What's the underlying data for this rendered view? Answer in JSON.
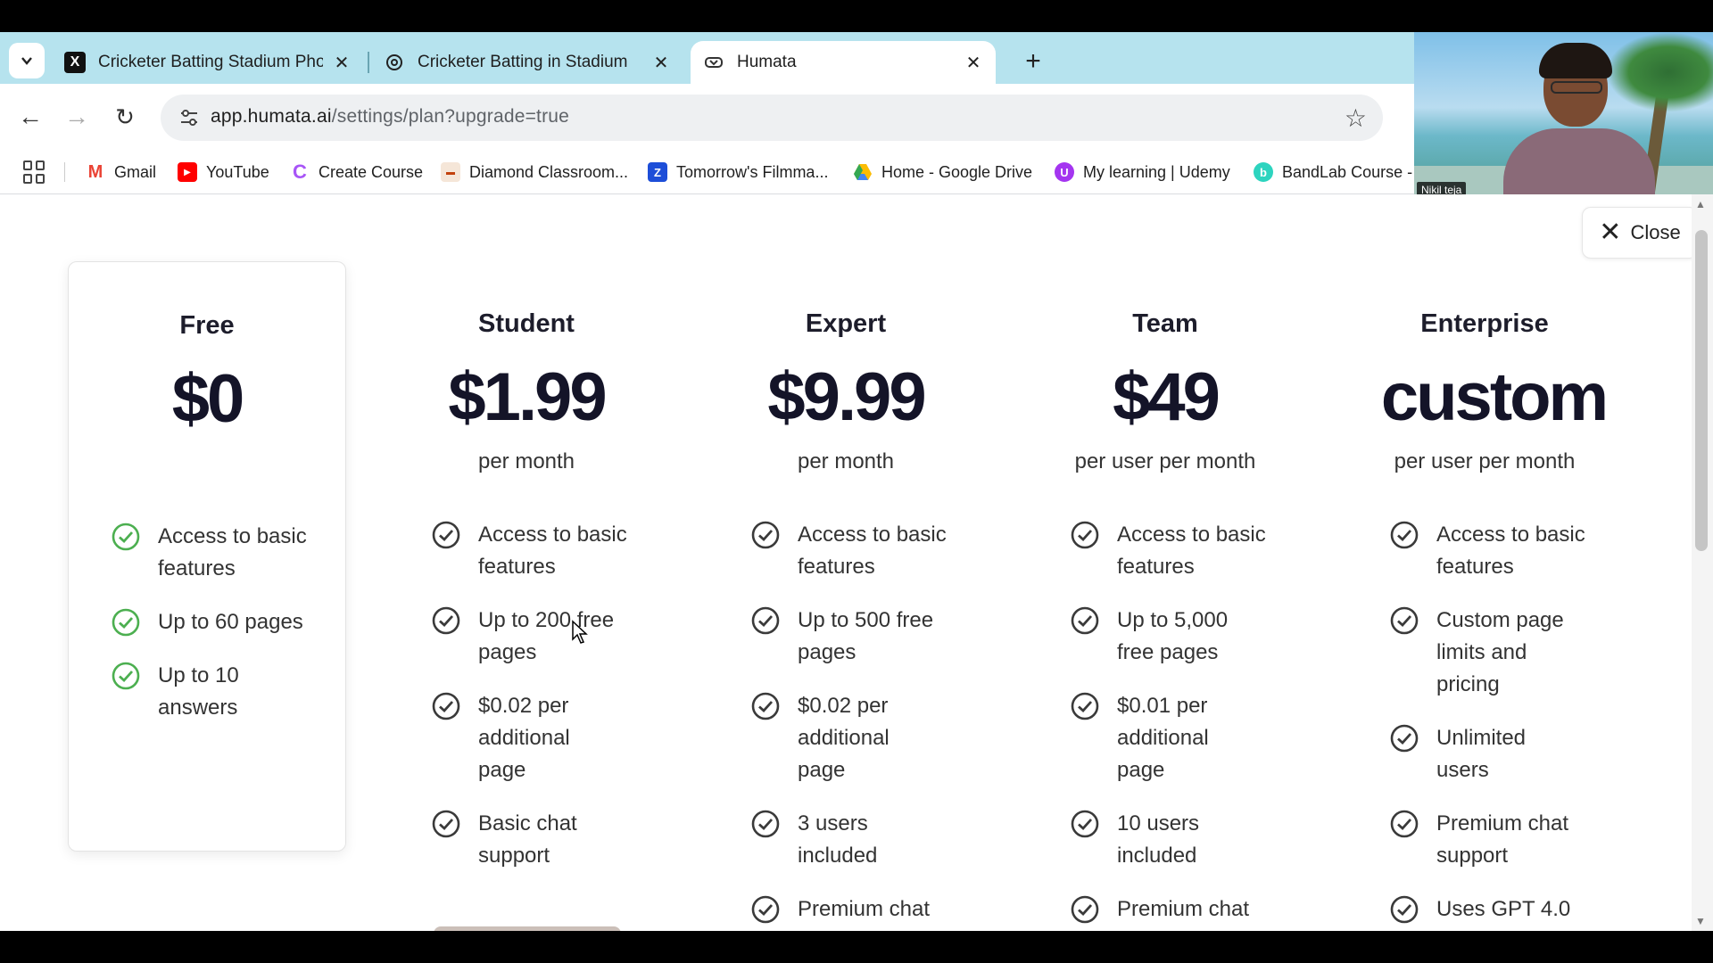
{
  "browser": {
    "tabs": [
      {
        "title": "Cricketer Batting Stadium Photo",
        "favicon": "x-logo-icon",
        "active": false
      },
      {
        "title": "Cricketer Batting in Stadium",
        "favicon": "openai-icon",
        "active": false
      },
      {
        "title": "Humata",
        "favicon": "humata-icon",
        "active": true
      }
    ],
    "url_host": "app.humata.ai",
    "url_path": "/settings/plan?upgrade=true",
    "bookmarks": [
      {
        "label": "Gmail",
        "icon": "gmail-icon",
        "color": "#ea4335"
      },
      {
        "label": "YouTube",
        "icon": "youtube-icon",
        "color": "#ff0000"
      },
      {
        "label": "Create Course",
        "icon": "create-course-icon",
        "color": "#a855f7"
      },
      {
        "label": "Diamond Classroom...",
        "icon": "diamond-icon",
        "color": "#c2410c"
      },
      {
        "label": "Tomorrow's Filmma...",
        "icon": "filmmaker-icon",
        "color": "#1d4ed8"
      },
      {
        "label": "Home - Google Drive",
        "icon": "google-drive-icon",
        "color": "#fbbc04"
      },
      {
        "label": "My learning | Udemy",
        "icon": "udemy-icon",
        "color": "#a435f0"
      },
      {
        "label": "BandLab Course -",
        "icon": "bandlab-icon",
        "color": "#2dd4bf"
      }
    ]
  },
  "webcam": {
    "name": "Nikil teja"
  },
  "page": {
    "close_label": "Close",
    "accent_free": "#4caf50",
    "accent_other": "#3a3a3a",
    "plans": [
      {
        "name": "Free",
        "price": "$0",
        "period": "",
        "features": [
          "Access to basic features",
          "Up to 60 pages",
          "Up to 10 answers"
        ]
      },
      {
        "name": "Student",
        "price": "$1.99",
        "period": "per month",
        "features": [
          "Access to basic features",
          "Up to 200 free pages",
          "$0.02 per additional page",
          "Basic chat support"
        ]
      },
      {
        "name": "Expert",
        "price": "$9.99",
        "period": "per month",
        "features": [
          "Access to basic features",
          "Up to 500 free pages",
          "$0.02 per additional page",
          "3 users included",
          "Premium chat"
        ]
      },
      {
        "name": "Team",
        "price": "$49",
        "period": "per user per month",
        "features": [
          "Access to basic features",
          "Up to 5,000 free pages",
          "$0.01 per additional page",
          "10 users included",
          "Premium chat"
        ]
      },
      {
        "name": "Enterprise",
        "price": "custom",
        "period": "per user per month",
        "features": [
          "Access to basic features",
          "Custom page limits and pricing",
          "Unlimited users",
          "Premium chat support",
          "Uses GPT 4.0"
        ]
      }
    ]
  }
}
